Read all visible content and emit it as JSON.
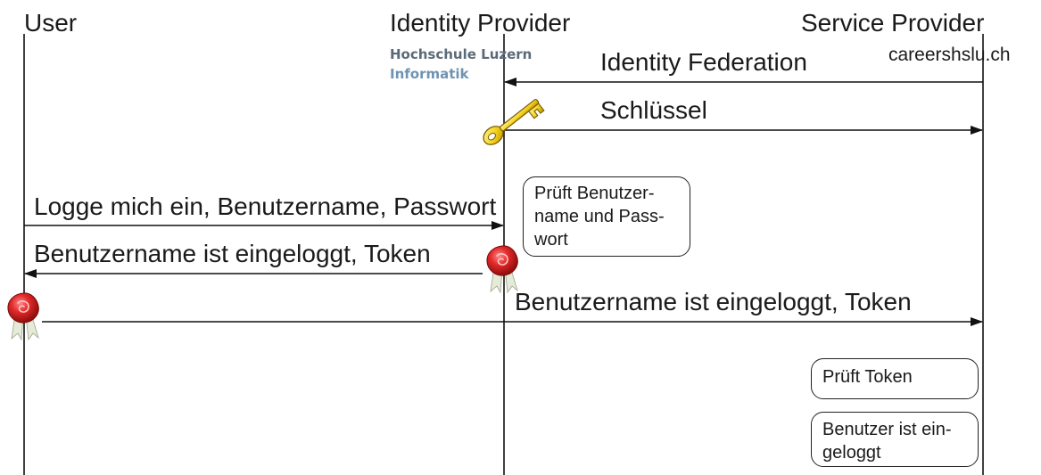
{
  "actors": {
    "user": "User",
    "identity_provider": "Identity Provider",
    "service_provider": "Service Provider"
  },
  "idp_logo": {
    "line1": "Hochschule Luzern",
    "line2": "Informatik",
    "colors": {
      "line1": "#5b6a78",
      "line2": "#6f93b0"
    }
  },
  "sp_domain": "careershslu.ch",
  "messages": {
    "identity_federation": "Identity Federation",
    "schluessel": "Schlüssel",
    "login": "Logge mich ein, Benutzername, Passwort",
    "logged_in_to_user": "Benutzername ist eingeloggt, Token",
    "logged_in_to_sp": "Benutzername ist eingeloggt, Token"
  },
  "notes": {
    "check_credentials": [
      "Prüft   Benutzer-",
      "name und Pass-",
      "wort"
    ],
    "check_token": [
      "Prüft Token"
    ],
    "user_logged_in": [
      "Benutzer ist ein-",
      "geloggt"
    ]
  },
  "icons": {
    "key": "key-icon",
    "seal": "wax-seal-icon",
    "key_color": "#f3d21c",
    "seal_color": "#d61f1f"
  }
}
